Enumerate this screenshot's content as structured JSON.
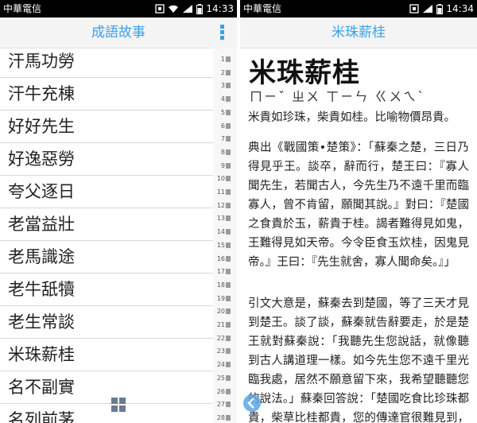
{
  "left": {
    "status": {
      "carrier": "中華電信",
      "time": "14:33"
    },
    "title": "成語故事",
    "items": [
      "汗馬功勞",
      "汗牛充棟",
      "好好先生",
      "好逸惡勞",
      "夸父逐日",
      "老當益壯",
      "老馬識途",
      "老牛舐犢",
      "老生常談",
      "米珠薪桂",
      "名不副實",
      "名列前茅"
    ],
    "index_numbers": [
      "1",
      "2",
      "3",
      "4",
      "5",
      "6",
      "7",
      "8",
      "9",
      "10",
      "11",
      "12",
      "13",
      "14",
      "15",
      "16",
      "17",
      "18",
      "19",
      "20",
      "21",
      "22",
      "23",
      "24",
      "25",
      "26",
      "27",
      "28"
    ]
  },
  "right": {
    "status": {
      "carrier": "中華電信",
      "time": "14:34"
    },
    "title": "米珠薪桂",
    "idiom": "米珠薪桂",
    "zhuyin": "ㄇㄧˇ ㄓㄨ ㄒㄧㄣ ㄍㄨㄟˋ",
    "meaning": "米貴如珍珠，柴貴如桂。比喻物價昂貴。",
    "source": "典出《戰國策•楚策》：「蘇秦之楚，三日乃得見乎王。談卒，辭而行，楚王曰：『寡人聞先生，若聞古人，今先生乃不遠千里而臨寡人，曾不肯留，願聞其說。』對曰：『楚國之食貴於玉，薪貴于桂。謁者難得見如鬼，王難得見如天帝。今令臣食玉炊桂，因鬼見帝。』王曰：『先生就舍，寡人聞命矣。』」",
    "explanation": "引文大意是，蘇秦去到楚國，等了三天才見到楚王。談了談，蘇秦就告辭要走，於是楚王就對蘇秦說：「我聽先生您說話，就像聽到古人講道理一樣。如今先生您不遠千里光臨我處，居然不願意留下來，我希望聽聽您的說法。」蘇秦回答說：「楚國吃食比珍珠都貴，柴草比桂都貴，您的傳達官很難見到，同仇一樣難見您"
  }
}
